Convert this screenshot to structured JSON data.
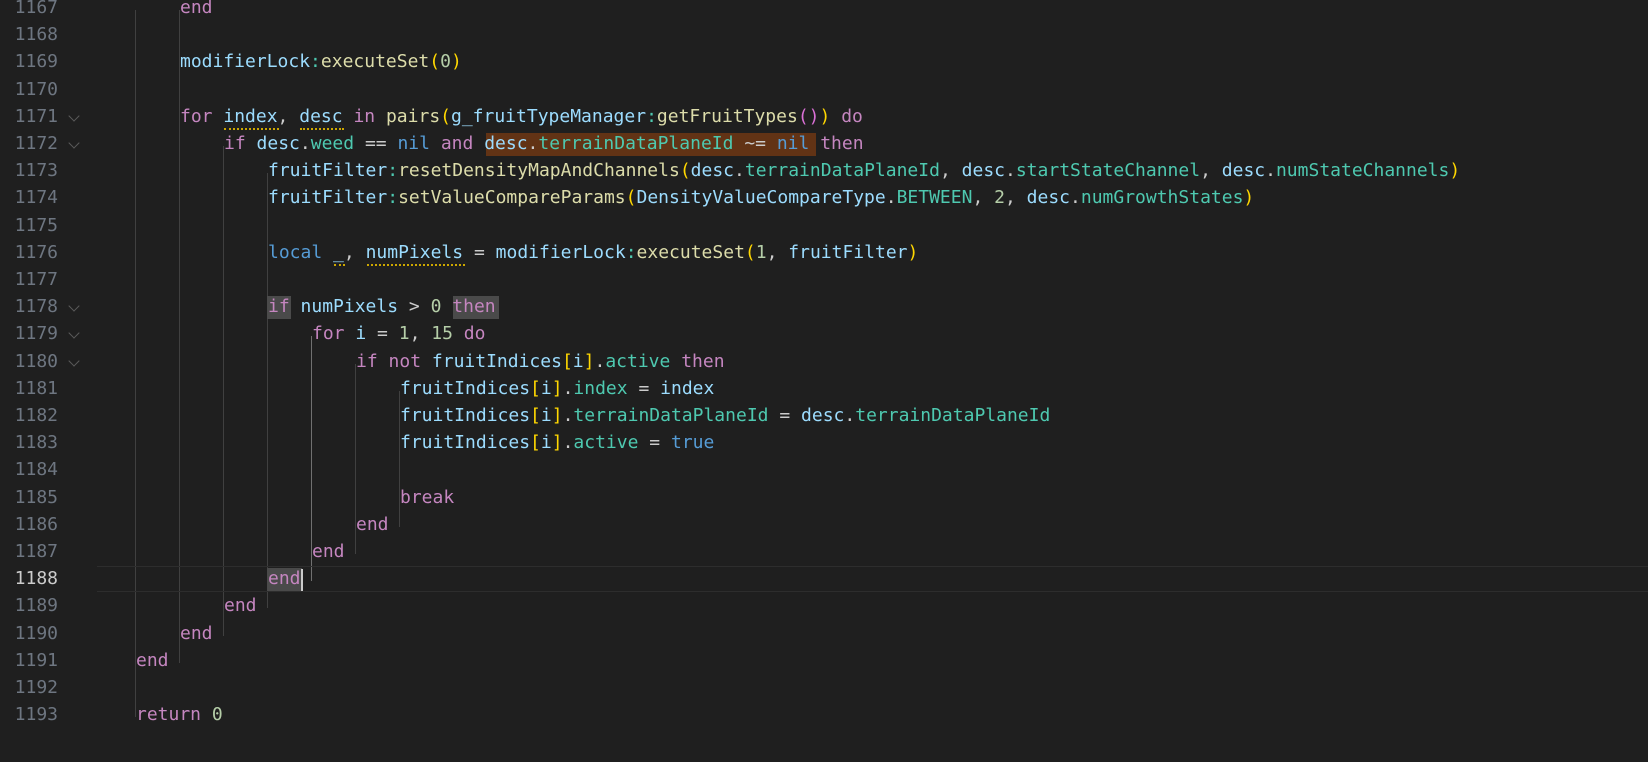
{
  "editor": {
    "current_line": "1188",
    "lines": [
      {
        "num": "1167",
        "text": "end"
      },
      {
        "num": "1168",
        "text": ""
      },
      {
        "num": "1169",
        "text": "modifierLock:executeSet(0)"
      },
      {
        "num": "1170",
        "text": ""
      },
      {
        "num": "1171",
        "text": "for index, desc in pairs(g_fruitTypeManager:getFruitTypes()) do"
      },
      {
        "num": "1172",
        "text": "if desc.weed == nil and desc.terrainDataPlaneId ~= nil then"
      },
      {
        "num": "1173",
        "text": "fruitFilter:resetDensityMapAndChannels(desc.terrainDataPlaneId, desc.startStateChannel, desc.numStateChannels)"
      },
      {
        "num": "1174",
        "text": "fruitFilter:setValueCompareParams(DensityValueCompareType.BETWEEN, 2, desc.numGrowthStates)"
      },
      {
        "num": "1175",
        "text": ""
      },
      {
        "num": "1176",
        "text": "local _, numPixels = modifierLock:executeSet(1, fruitFilter)"
      },
      {
        "num": "1177",
        "text": ""
      },
      {
        "num": "1178",
        "text": "if numPixels > 0 then"
      },
      {
        "num": "1179",
        "text": "for i = 1, 15 do"
      },
      {
        "num": "1180",
        "text": "if not fruitIndices[i].active then"
      },
      {
        "num": "1181",
        "text": "fruitIndices[i].index = index"
      },
      {
        "num": "1182",
        "text": "fruitIndices[i].terrainDataPlaneId = desc.terrainDataPlaneId"
      },
      {
        "num": "1183",
        "text": "fruitIndices[i].active = true"
      },
      {
        "num": "1184",
        "text": ""
      },
      {
        "num": "1185",
        "text": "break"
      },
      {
        "num": "1186",
        "text": "end"
      },
      {
        "num": "1187",
        "text": "end"
      },
      {
        "num": "1188",
        "text": "end"
      },
      {
        "num": "1189",
        "text": "end"
      },
      {
        "num": "1190",
        "text": "end"
      },
      {
        "num": "1191",
        "text": "end"
      },
      {
        "num": "1192",
        "text": ""
      },
      {
        "num": "1193",
        "text": "return 0"
      }
    ]
  },
  "colors": {
    "background": "#1f1f1f",
    "keyword": "#c586c0",
    "storage": "#569cd6",
    "variable": "#9cdcfe",
    "function": "#dcdcaa",
    "property": "#4ec9b0",
    "number": "#b5cea8",
    "bracket": "#ffd700",
    "selection": "#623315"
  }
}
